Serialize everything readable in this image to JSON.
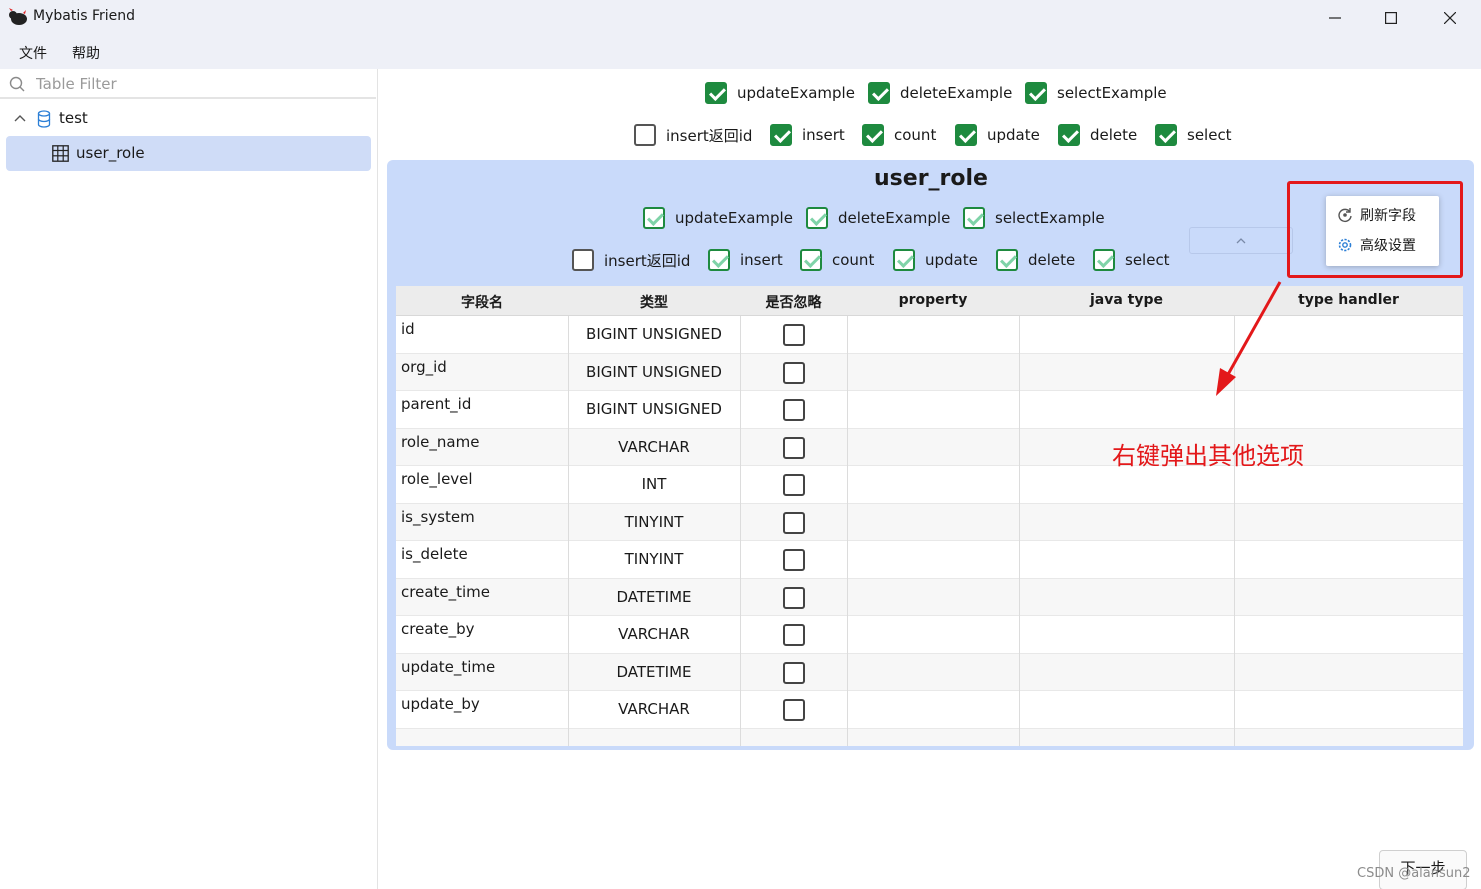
{
  "window": {
    "title": "Mybatis Friend",
    "minimize_glyph": "—",
    "maximize_glyph": "☐",
    "close_glyph": "✕"
  },
  "menu": {
    "items": [
      "文件",
      "帮助"
    ]
  },
  "sidebar": {
    "filter_placeholder": "Table Filter",
    "database": "test",
    "table": "user_role"
  },
  "global_options": {
    "row1": [
      {
        "label": "updateExample",
        "checked": true
      },
      {
        "label": "deleteExample",
        "checked": true
      },
      {
        "label": "selectExample",
        "checked": true
      }
    ],
    "row2": [
      {
        "label": "insert返回id",
        "checked": false
      },
      {
        "label": "insert",
        "checked": true
      },
      {
        "label": "count",
        "checked": true
      },
      {
        "label": "update",
        "checked": true
      },
      {
        "label": "delete",
        "checked": true
      },
      {
        "label": "select",
        "checked": true
      }
    ]
  },
  "table_panel": {
    "title": "user_role",
    "row1": [
      {
        "label": "updateExample",
        "checked": true
      },
      {
        "label": "deleteExample",
        "checked": true
      },
      {
        "label": "selectExample",
        "checked": true
      }
    ],
    "row2": [
      {
        "label": "insert返回id",
        "checked": false
      },
      {
        "label": "insert",
        "checked": true
      },
      {
        "label": "count",
        "checked": true
      },
      {
        "label": "update",
        "checked": true
      },
      {
        "label": "delete",
        "checked": true
      },
      {
        "label": "select",
        "checked": true
      }
    ],
    "columns": [
      "字段名",
      "类型",
      "是否忽略",
      "property",
      "java type",
      "type handler"
    ],
    "rows": [
      {
        "name": "id",
        "type": "BIGINT UNSIGNED",
        "ignore": false
      },
      {
        "name": "org_id",
        "type": "BIGINT UNSIGNED",
        "ignore": false
      },
      {
        "name": "parent_id",
        "type": "BIGINT UNSIGNED",
        "ignore": false
      },
      {
        "name": "role_name",
        "type": "VARCHAR",
        "ignore": false
      },
      {
        "name": "role_level",
        "type": "INT",
        "ignore": false
      },
      {
        "name": "is_system",
        "type": "TINYINT",
        "ignore": false
      },
      {
        "name": "is_delete",
        "type": "TINYINT",
        "ignore": false
      },
      {
        "name": "create_time",
        "type": "DATETIME",
        "ignore": false
      },
      {
        "name": "create_by",
        "type": "VARCHAR",
        "ignore": false
      },
      {
        "name": "update_time",
        "type": "DATETIME",
        "ignore": false
      },
      {
        "name": "update_by",
        "type": "VARCHAR",
        "ignore": false
      }
    ]
  },
  "context_menu": {
    "items": [
      {
        "label": "刷新字段",
        "icon": "refresh-icon"
      },
      {
        "label": "高级设置",
        "icon": "gear-icon"
      }
    ]
  },
  "annotation": {
    "text": "右键弹出其他选项",
    "color": "#e3181a"
  },
  "footer": {
    "next_button": "下一步",
    "watermark": "CSDN @alansun2"
  },
  "colors": {
    "accent_check": "#1e8a3f",
    "panel_bg": "#c9dafa",
    "selected_row": "#cfdcf7"
  }
}
